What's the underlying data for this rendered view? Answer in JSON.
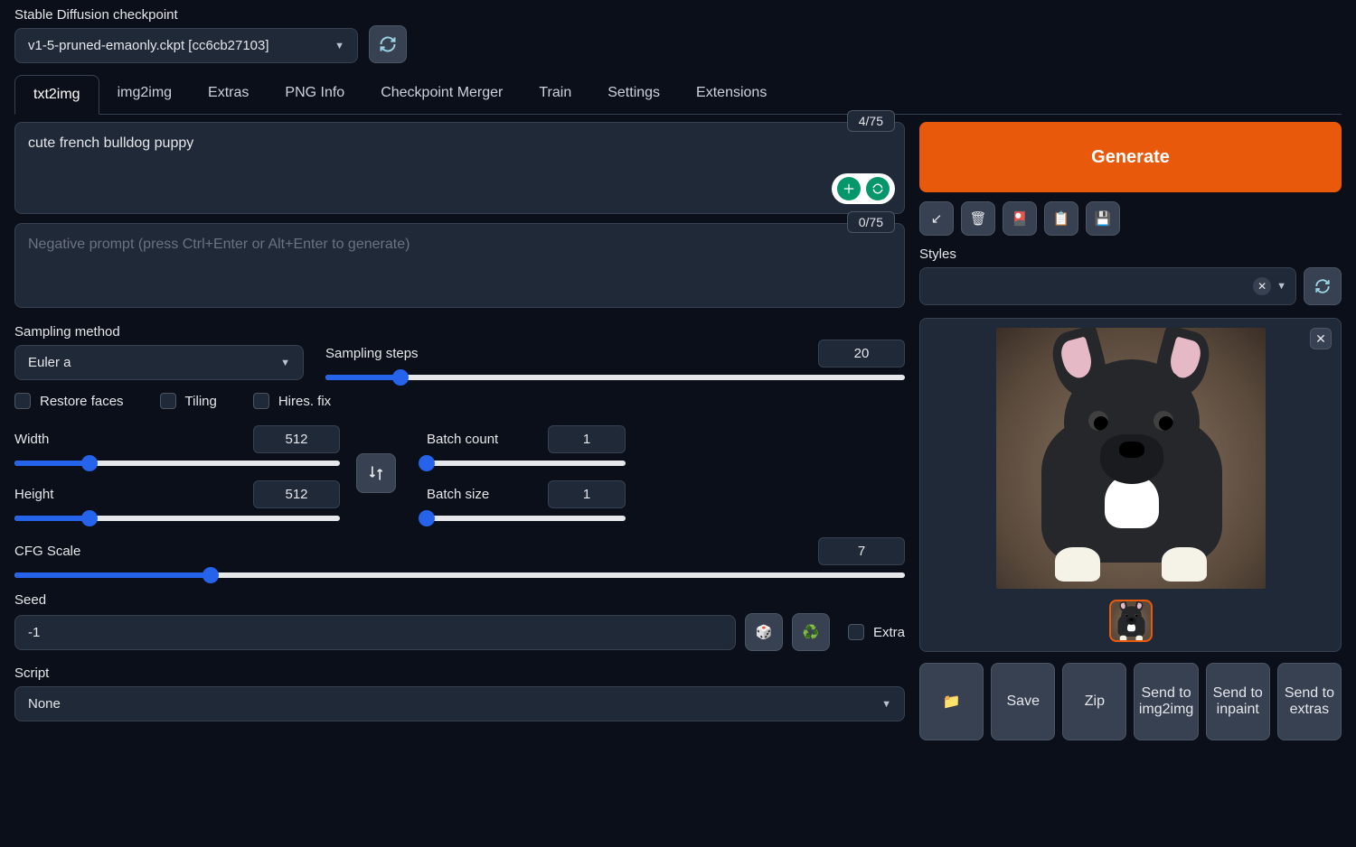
{
  "checkpoint": {
    "label": "Stable Diffusion checkpoint",
    "value": "v1-5-pruned-emaonly.ckpt [cc6cb27103]"
  },
  "tabs": [
    "txt2img",
    "img2img",
    "Extras",
    "PNG Info",
    "Checkpoint Merger",
    "Train",
    "Settings",
    "Extensions"
  ],
  "active_tab": "txt2img",
  "prompt": {
    "value": "cute french bulldog puppy",
    "token_count": "4/75"
  },
  "neg_prompt": {
    "placeholder": "Negative prompt (press Ctrl+Enter or Alt+Enter to generate)",
    "token_count": "0/75"
  },
  "generate_label": "Generate",
  "styles_label": "Styles",
  "sampling_method": {
    "label": "Sampling method",
    "value": "Euler a"
  },
  "sampling_steps": {
    "label": "Sampling steps",
    "value": "20",
    "pct": 13
  },
  "checks": {
    "restore": "Restore faces",
    "tiling": "Tiling",
    "hires": "Hires. fix"
  },
  "width": {
    "label": "Width",
    "value": "512",
    "pct": 23
  },
  "height": {
    "label": "Height",
    "value": "512",
    "pct": 23
  },
  "batch_count": {
    "label": "Batch count",
    "value": "1",
    "pct": 0
  },
  "batch_size": {
    "label": "Batch size",
    "value": "1",
    "pct": 0
  },
  "cfg": {
    "label": "CFG Scale",
    "value": "7",
    "pct": 22
  },
  "seed": {
    "label": "Seed",
    "value": "-1",
    "extra_label": "Extra"
  },
  "script": {
    "label": "Script",
    "value": "None"
  },
  "output_buttons": {
    "folder": "📁",
    "save": "Save",
    "zip": "Zip",
    "img2img": "Send to img2img",
    "inpaint": "Send to inpaint",
    "extras": "Send to extras"
  }
}
